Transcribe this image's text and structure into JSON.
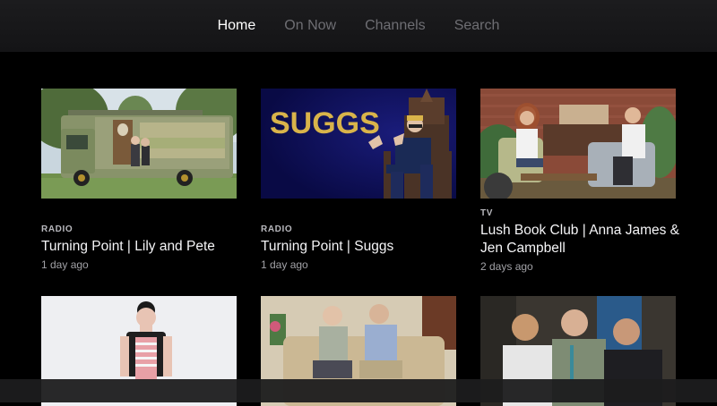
{
  "nav": {
    "items": [
      {
        "label": "Home",
        "active": true
      },
      {
        "label": "On Now",
        "active": false
      },
      {
        "label": "Channels",
        "active": false
      },
      {
        "label": "Search",
        "active": false
      }
    ]
  },
  "cards": [
    {
      "category": "RADIO",
      "title": "Turning Point | Lily and Pete",
      "time": "1 day ago"
    },
    {
      "category": "RADIO",
      "title": "Turning Point | Suggs",
      "time": "1 day ago",
      "thumb_text": "SUGGS"
    },
    {
      "category": "TV",
      "title": "Lush Book Club | Anna James & Jen Campbell",
      "time": "2 days ago"
    },
    {
      "category": "",
      "title": "",
      "time": ""
    },
    {
      "category": "",
      "title": "",
      "time": ""
    },
    {
      "category": "",
      "title": "",
      "time": ""
    }
  ],
  "colors": {
    "accent_gold": "#d9b44a",
    "nav_inactive": "#6e6e73",
    "background": "#000000"
  }
}
